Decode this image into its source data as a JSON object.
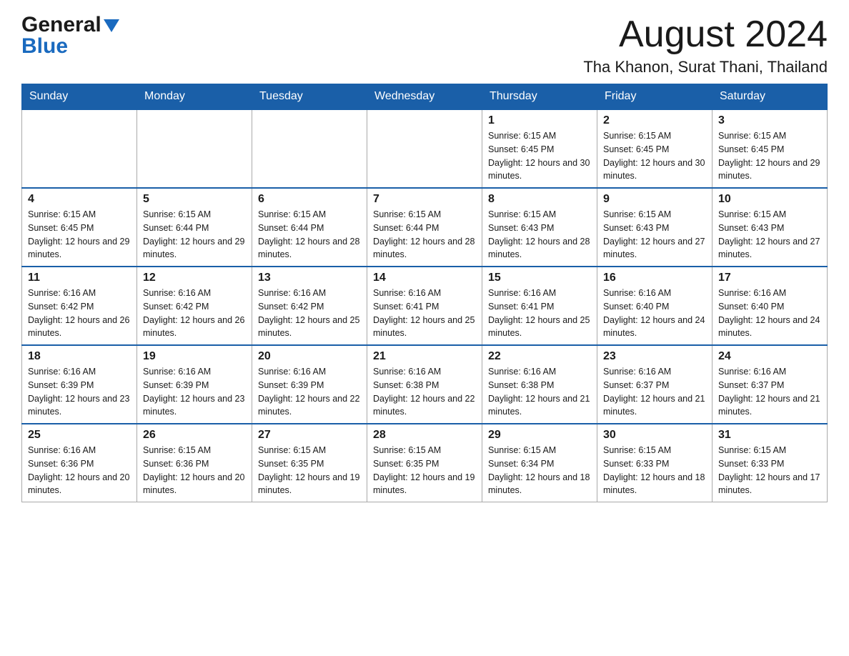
{
  "header": {
    "logo_general": "General",
    "logo_blue": "Blue",
    "month_title": "August 2024",
    "location": "Tha Khanon, Surat Thani, Thailand"
  },
  "days_of_week": [
    "Sunday",
    "Monday",
    "Tuesday",
    "Wednesday",
    "Thursday",
    "Friday",
    "Saturday"
  ],
  "weeks": [
    [
      {
        "day": "",
        "info": ""
      },
      {
        "day": "",
        "info": ""
      },
      {
        "day": "",
        "info": ""
      },
      {
        "day": "",
        "info": ""
      },
      {
        "day": "1",
        "info": "Sunrise: 6:15 AM\nSunset: 6:45 PM\nDaylight: 12 hours and 30 minutes."
      },
      {
        "day": "2",
        "info": "Sunrise: 6:15 AM\nSunset: 6:45 PM\nDaylight: 12 hours and 30 minutes."
      },
      {
        "day": "3",
        "info": "Sunrise: 6:15 AM\nSunset: 6:45 PM\nDaylight: 12 hours and 29 minutes."
      }
    ],
    [
      {
        "day": "4",
        "info": "Sunrise: 6:15 AM\nSunset: 6:45 PM\nDaylight: 12 hours and 29 minutes."
      },
      {
        "day": "5",
        "info": "Sunrise: 6:15 AM\nSunset: 6:44 PM\nDaylight: 12 hours and 29 minutes."
      },
      {
        "day": "6",
        "info": "Sunrise: 6:15 AM\nSunset: 6:44 PM\nDaylight: 12 hours and 28 minutes."
      },
      {
        "day": "7",
        "info": "Sunrise: 6:15 AM\nSunset: 6:44 PM\nDaylight: 12 hours and 28 minutes."
      },
      {
        "day": "8",
        "info": "Sunrise: 6:15 AM\nSunset: 6:43 PM\nDaylight: 12 hours and 28 minutes."
      },
      {
        "day": "9",
        "info": "Sunrise: 6:15 AM\nSunset: 6:43 PM\nDaylight: 12 hours and 27 minutes."
      },
      {
        "day": "10",
        "info": "Sunrise: 6:15 AM\nSunset: 6:43 PM\nDaylight: 12 hours and 27 minutes."
      }
    ],
    [
      {
        "day": "11",
        "info": "Sunrise: 6:16 AM\nSunset: 6:42 PM\nDaylight: 12 hours and 26 minutes."
      },
      {
        "day": "12",
        "info": "Sunrise: 6:16 AM\nSunset: 6:42 PM\nDaylight: 12 hours and 26 minutes."
      },
      {
        "day": "13",
        "info": "Sunrise: 6:16 AM\nSunset: 6:42 PM\nDaylight: 12 hours and 25 minutes."
      },
      {
        "day": "14",
        "info": "Sunrise: 6:16 AM\nSunset: 6:41 PM\nDaylight: 12 hours and 25 minutes."
      },
      {
        "day": "15",
        "info": "Sunrise: 6:16 AM\nSunset: 6:41 PM\nDaylight: 12 hours and 25 minutes."
      },
      {
        "day": "16",
        "info": "Sunrise: 6:16 AM\nSunset: 6:40 PM\nDaylight: 12 hours and 24 minutes."
      },
      {
        "day": "17",
        "info": "Sunrise: 6:16 AM\nSunset: 6:40 PM\nDaylight: 12 hours and 24 minutes."
      }
    ],
    [
      {
        "day": "18",
        "info": "Sunrise: 6:16 AM\nSunset: 6:39 PM\nDaylight: 12 hours and 23 minutes."
      },
      {
        "day": "19",
        "info": "Sunrise: 6:16 AM\nSunset: 6:39 PM\nDaylight: 12 hours and 23 minutes."
      },
      {
        "day": "20",
        "info": "Sunrise: 6:16 AM\nSunset: 6:39 PM\nDaylight: 12 hours and 22 minutes."
      },
      {
        "day": "21",
        "info": "Sunrise: 6:16 AM\nSunset: 6:38 PM\nDaylight: 12 hours and 22 minutes."
      },
      {
        "day": "22",
        "info": "Sunrise: 6:16 AM\nSunset: 6:38 PM\nDaylight: 12 hours and 21 minutes."
      },
      {
        "day": "23",
        "info": "Sunrise: 6:16 AM\nSunset: 6:37 PM\nDaylight: 12 hours and 21 minutes."
      },
      {
        "day": "24",
        "info": "Sunrise: 6:16 AM\nSunset: 6:37 PM\nDaylight: 12 hours and 21 minutes."
      }
    ],
    [
      {
        "day": "25",
        "info": "Sunrise: 6:16 AM\nSunset: 6:36 PM\nDaylight: 12 hours and 20 minutes."
      },
      {
        "day": "26",
        "info": "Sunrise: 6:15 AM\nSunset: 6:36 PM\nDaylight: 12 hours and 20 minutes."
      },
      {
        "day": "27",
        "info": "Sunrise: 6:15 AM\nSunset: 6:35 PM\nDaylight: 12 hours and 19 minutes."
      },
      {
        "day": "28",
        "info": "Sunrise: 6:15 AM\nSunset: 6:35 PM\nDaylight: 12 hours and 19 minutes."
      },
      {
        "day": "29",
        "info": "Sunrise: 6:15 AM\nSunset: 6:34 PM\nDaylight: 12 hours and 18 minutes."
      },
      {
        "day": "30",
        "info": "Sunrise: 6:15 AM\nSunset: 6:33 PM\nDaylight: 12 hours and 18 minutes."
      },
      {
        "day": "31",
        "info": "Sunrise: 6:15 AM\nSunset: 6:33 PM\nDaylight: 12 hours and 17 minutes."
      }
    ]
  ]
}
